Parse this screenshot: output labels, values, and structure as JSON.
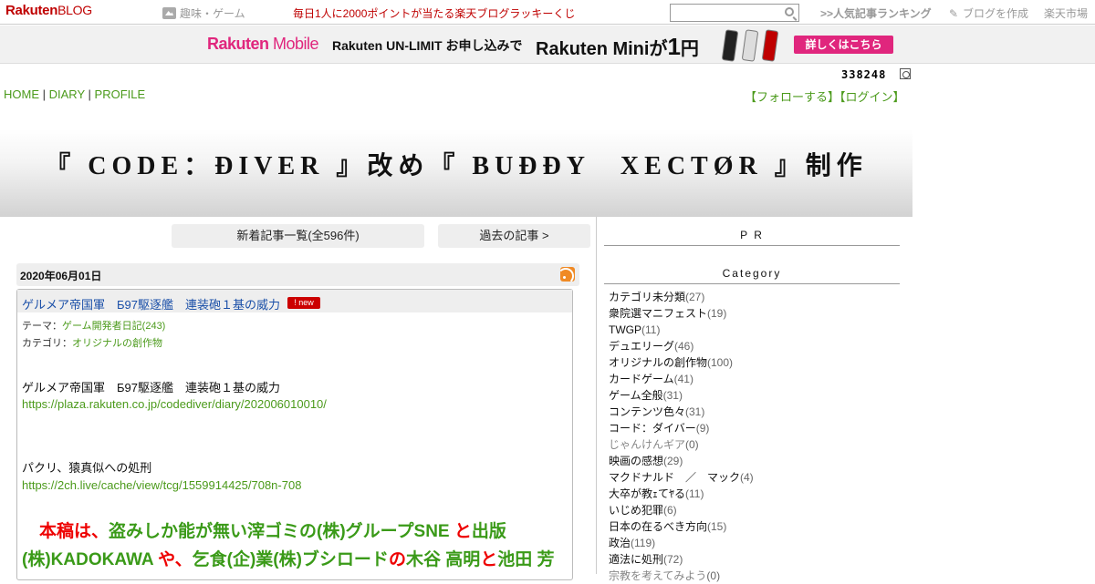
{
  "topbar": {
    "logo_main": "Rakuten",
    "logo_sub": "BLOG",
    "hobby": "趣味・ゲーム",
    "lucky": "毎日1人に2000ポイントが当たる楽天ブログラッキーくじ",
    "ranking": ">>人気記事ランキング",
    "make_blog": "ブログを作成",
    "ichiba": "楽天市場"
  },
  "banner": {
    "brand": "Rakuten",
    "brand_sub": "Mobile",
    "unlimit": "Rakuten UN-LIMIT お申し込みで",
    "mini": "Rakuten Miniが",
    "price": "1",
    "yen": "円",
    "button": "詳しくはこちら",
    "phone_colors": [
      "#222222",
      "#dddddd",
      "#bf0000"
    ]
  },
  "counter": "338248",
  "nav": {
    "home": "HOME",
    "diary": "DIARY",
    "profile": "PROFILE",
    "sep": "|"
  },
  "follow": {
    "follow": "【フォローする】",
    "login": "【ログイン】"
  },
  "title": "『 CODE：ÐIVER 』改め『 BUÐÐY　XECTØR 』制作",
  "buttons": {
    "new_articles": "新着記事一覧(全596件)",
    "past": "過去の記事 >"
  },
  "post": {
    "date": "2020年06月01日",
    "title": "ゲルメア帝国軍　Б97駆逐艦　連装砲１基の威力",
    "badge": "new",
    "theme_label": "テーマ：",
    "theme": "ゲーム開発者日記(243)",
    "category_label": "カテゴリ：",
    "category": "オリジナルの創作物",
    "line1": "ゲルメア帝国軍　Б97駆逐艦　連装砲１基の威力",
    "link1": "https://plaza.rakuten.co.jp/codediver/diary/202006010010/",
    "line2": "パクリ、猿真似への処刑",
    "link2": "https://2ch.live/cache/view/tcg/1559914425/708n-708",
    "big_parts": [
      {
        "text": "　本稿は、",
        "color": "red"
      },
      {
        "text": "盗みしか能が無い滓ゴミの(株)グループSNE",
        "color": "green"
      },
      {
        "text": " と",
        "color": "red"
      },
      {
        "text": "出版(株)KADOKAWA",
        "color": "green"
      },
      {
        "text": " や、",
        "color": "red"
      },
      {
        "text": "乞食(企)業(株)ブシロード",
        "color": "green"
      },
      {
        "text": "の",
        "color": "red"
      },
      {
        "text": "木谷 高明",
        "color": "green"
      },
      {
        "text": "と",
        "color": "red"
      },
      {
        "text": "池田 芳",
        "color": "green"
      }
    ]
  },
  "sidebar": {
    "pr": "P R",
    "category": "Category",
    "items": [
      {
        "name": "カテゴリ未分類",
        "count": "(27)"
      },
      {
        "name": "衆院選マニフェスト",
        "count": "(19)"
      },
      {
        "name": "TWGP",
        "count": "(11)"
      },
      {
        "name": "デュエリーグ",
        "count": "(46)"
      },
      {
        "name": "オリジナルの創作物",
        "count": "(100)"
      },
      {
        "name": "カードゲーム",
        "count": "(41)"
      },
      {
        "name": "ゲーム全般",
        "count": "(31)"
      },
      {
        "name": "コンテンツ色々",
        "count": "(31)"
      },
      {
        "name": "コード：ダイバー",
        "count": "(9)"
      },
      {
        "name": "じゃんけんギア",
        "count": "(0)"
      },
      {
        "name": "映画の感想",
        "count": "(29)"
      },
      {
        "name": "マクドナルド　／　マック",
        "count": "(4)"
      },
      {
        "name": "大卒が教ｪてﾔる",
        "count": "(11)"
      },
      {
        "name": "いじめ犯罪",
        "count": "(6)"
      },
      {
        "name": "日本の在るべき方向",
        "count": "(15)"
      },
      {
        "name": "政治",
        "count": "(119)"
      },
      {
        "name": "適法に処刑",
        "count": "(72)"
      },
      {
        "name": "宗教を考えてみよう",
        "count": "(0)"
      }
    ]
  }
}
